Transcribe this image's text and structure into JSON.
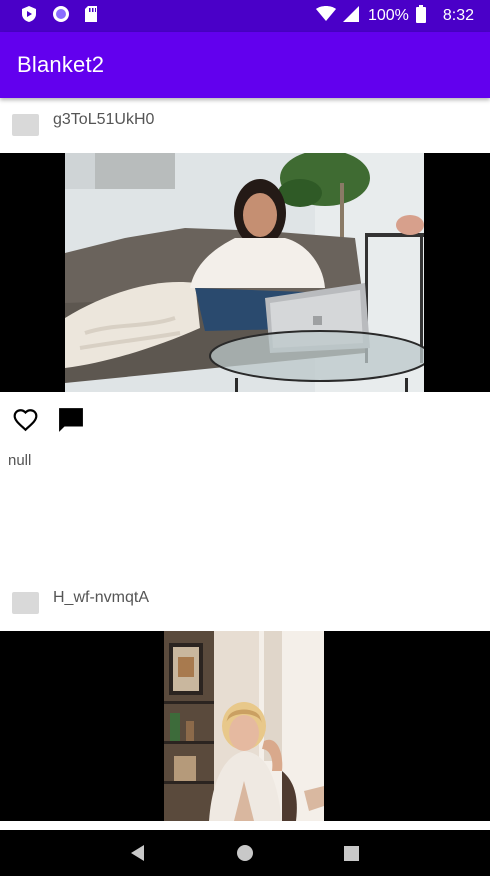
{
  "status_bar": {
    "battery_percent": "100%",
    "time": "8:32",
    "icons": [
      "shield-icon",
      "circle-app-icon",
      "sd-card-icon",
      "wifi-icon",
      "signal-icon",
      "battery-icon"
    ]
  },
  "app_bar": {
    "title": "Blanket2"
  },
  "posts": [
    {
      "username": "g3ToL51UkH0",
      "photo": "woman-on-sofa-with-laptop-photo",
      "caption": "null"
    },
    {
      "username": "H_wf-nvmqtA",
      "photo": "woman-fixing-hair-photo"
    }
  ],
  "actions": {
    "like_icon": "heart-outline-icon",
    "comment_icon": "comment-icon"
  },
  "nav_bar": {
    "buttons": [
      "back-icon",
      "home-icon",
      "recents-icon"
    ]
  },
  "colors": {
    "status_bar": "#4a00c8",
    "app_bar": "#6200ee",
    "photo_letterbox": "#000000"
  }
}
